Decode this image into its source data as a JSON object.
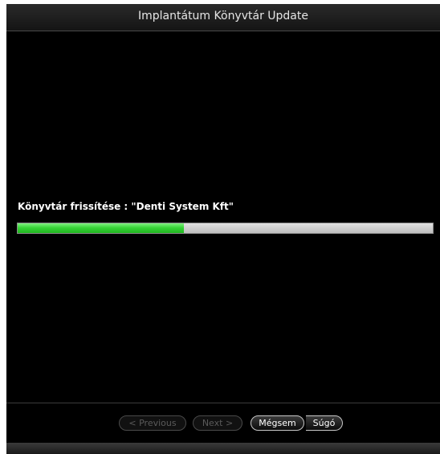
{
  "window": {
    "title": "Implantátum Könyvtár Update"
  },
  "status": {
    "text": "Könyvtár frissítése : \"Denti System Kft\""
  },
  "progress": {
    "percent": 40,
    "fill_color": "#37d437"
  },
  "footer": {
    "previous_label": "< Previous",
    "next_label": "Next >",
    "cancel_label": "Mégsem",
    "help_label": "Súgó"
  }
}
